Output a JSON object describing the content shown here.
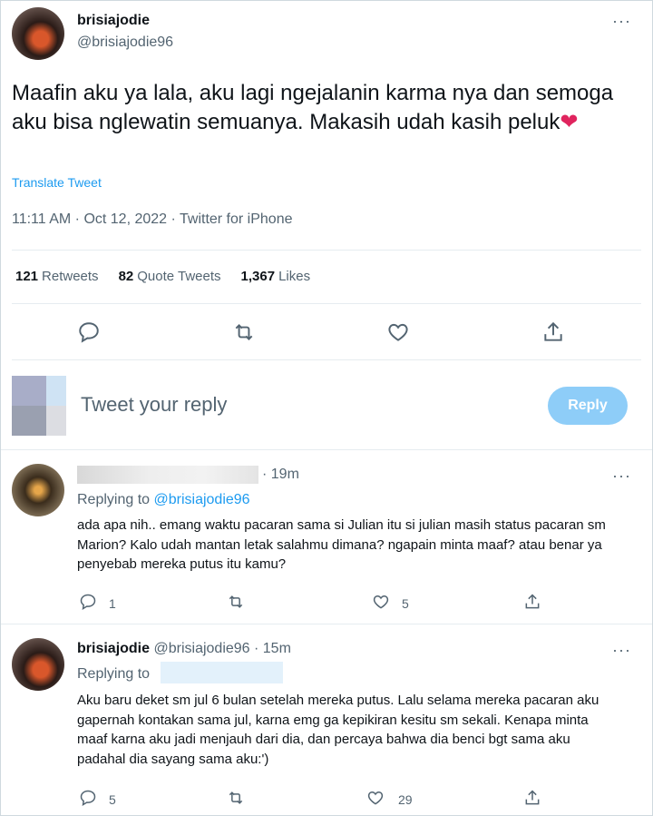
{
  "tweet": {
    "name": "brisiajodie",
    "handle": "@brisiajodie96",
    "text": "Maafin aku ya lala, aku lagi ngejalanin karma nya dan semoga aku bisa nglewatin semuanya. Makasih udah kasih peluk",
    "emoji": "❤",
    "translate": "Translate Tweet",
    "meta": "11:11 AM · Oct 12, 2022 · Twitter for iPhone",
    "stats": [
      {
        "value": "121",
        "label": "Retweets"
      },
      {
        "value": "82",
        "label": "Quote Tweets"
      },
      {
        "value": "1,367",
        "label": "Likes"
      }
    ],
    "more": "···"
  },
  "composer": {
    "placeholder": "Tweet your reply",
    "button": "Reply"
  },
  "replies": [
    {
      "time": "· 19m",
      "replying_prefix": "Replying to",
      "replying_handle": "@brisiajodie96",
      "text": "ada apa nih.. emang waktu pacaran sama si Julian itu si julian masih status pacaran sm Marion? Kalo udah mantan letak salahmu dimana? ngapain minta maaf? atau benar ya penyebab mereka putus itu kamu?",
      "reply_count": "1",
      "like_count": "5"
    },
    {
      "name": "brisiajodie",
      "handle_time": "@brisiajodie96 · 15m",
      "replying_prefix": "Replying to",
      "text": "Aku baru deket sm jul 6 bulan setelah mereka putus. Lalu selama mereka pacaran aku gapernah kontakan sama jul, karna emg ga kepikiran kesitu sm sekali. Kenapa minta maaf karna aku jadi menjauh dari dia, dan percaya bahwa dia benci bgt sama aku padahal dia sayang sama aku:')",
      "reply_count": "5",
      "like_count": "29"
    }
  ],
  "icons": [
    "reply-icon",
    "retweet-icon",
    "like-icon",
    "share-icon",
    "more-icon"
  ],
  "colors": {
    "accent": "#1d9bf0",
    "muted": "#536471",
    "button": "#8ecdf8",
    "heart": "#e0245e"
  }
}
